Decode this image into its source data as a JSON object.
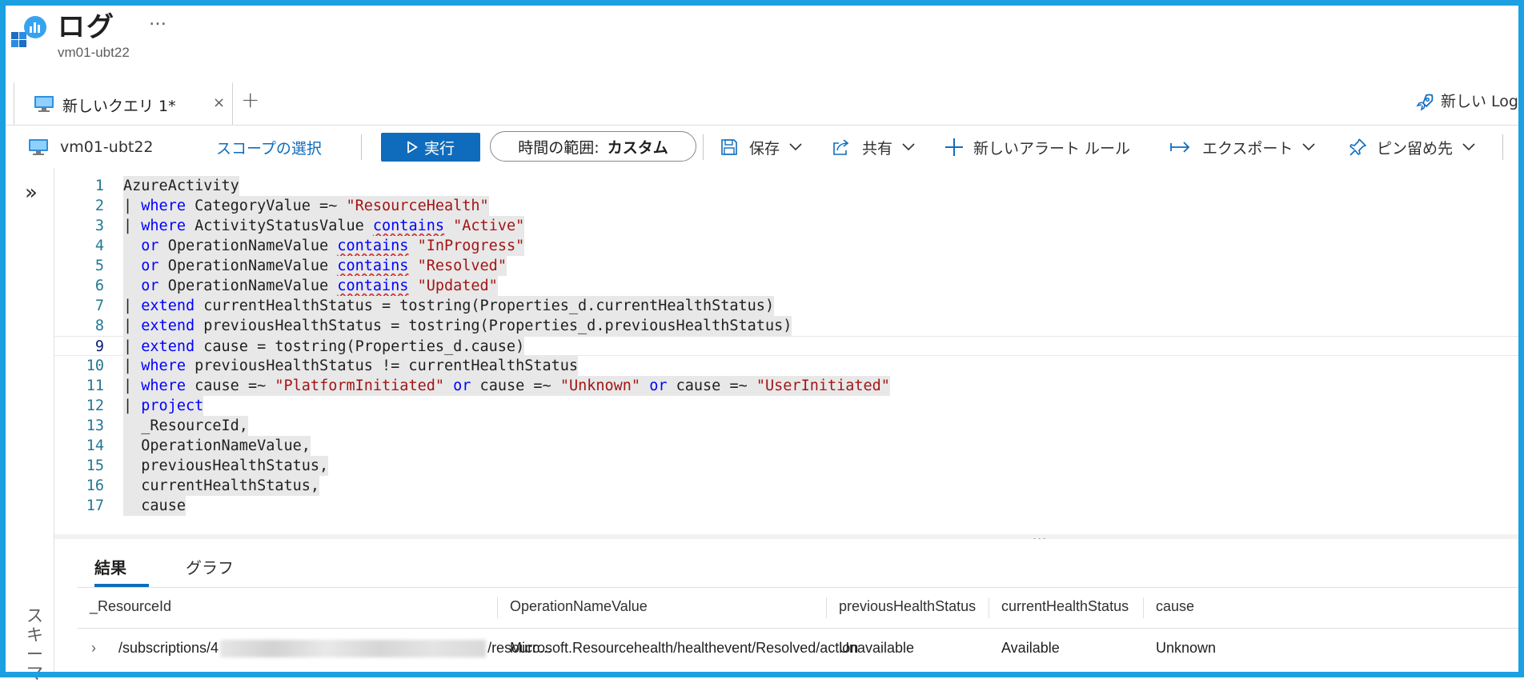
{
  "header": {
    "title": "ログ",
    "more": "…",
    "subtitle": "vm01-ubt22"
  },
  "tabs": {
    "active_label": "新しいクエリ 1*",
    "close": "×",
    "add": "+",
    "new_logs": "新しい Log"
  },
  "toolbar": {
    "scope_name": "vm01-ubt22",
    "scope_link": "スコープの選択",
    "run": "実行",
    "time_range_label": "時間の範囲:",
    "time_range_value": "カスタム",
    "save": "保存",
    "share": "共有",
    "new_alert": "新しいアラート ルール",
    "export": "エクスポート",
    "pin": "ピン留め先"
  },
  "rail": {
    "expand": "»",
    "schema": "スキーマ"
  },
  "editor": {
    "line_numbers": [
      "1",
      "2",
      "3",
      "4",
      "5",
      "6",
      "7",
      "8",
      "9",
      "10",
      "11",
      "12",
      "13",
      "14",
      "15",
      "16",
      "17"
    ],
    "current_line": 9,
    "lines": [
      "AzureActivity",
      "| where CategoryValue =~ \"ResourceHealth\"",
      "| where ActivityStatusValue contains \"Active\"",
      "  or OperationNameValue contains \"InProgress\"",
      "  or OperationNameValue contains \"Resolved\"",
      "  or OperationNameValue contains \"Updated\"",
      "| extend currentHealthStatus = tostring(Properties_d.currentHealthStatus)",
      "| extend previousHealthStatus = tostring(Properties_d.previousHealthStatus)",
      "| extend cause = tostring(Properties_d.cause)",
      "| where previousHealthStatus != currentHealthStatus",
      "| where cause =~ \"PlatformInitiated\" or cause =~ \"Unknown\" or cause =~ \"UserInitiated\"",
      "| project",
      "  _ResourceId,",
      "  OperationNameValue,",
      "  previousHealthStatus,",
      "  currentHealthStatus,",
      "  cause"
    ]
  },
  "splitter": {
    "grip": "..."
  },
  "results": {
    "tabs": [
      "結果",
      "グラフ"
    ],
    "columns": [
      "_ResourceId",
      "OperationNameValue",
      "previousHealthStatus",
      "currentHealthStatus",
      "cause"
    ],
    "rows": [
      {
        "expand": "›",
        "resource_prefix": "/subscriptions/4",
        "resource_suffix": "/resourc...",
        "operation": "Microsoft.Resourcehealth/healthevent/Resolved/action",
        "previous": "Unavailable",
        "current": "Available",
        "cause": "Unknown"
      }
    ]
  },
  "colors": {
    "frame": "#1ca0e2",
    "accent": "#0f6cbd",
    "keyword": "#0000ff",
    "string": "#a31515",
    "line_number": "#237893"
  }
}
